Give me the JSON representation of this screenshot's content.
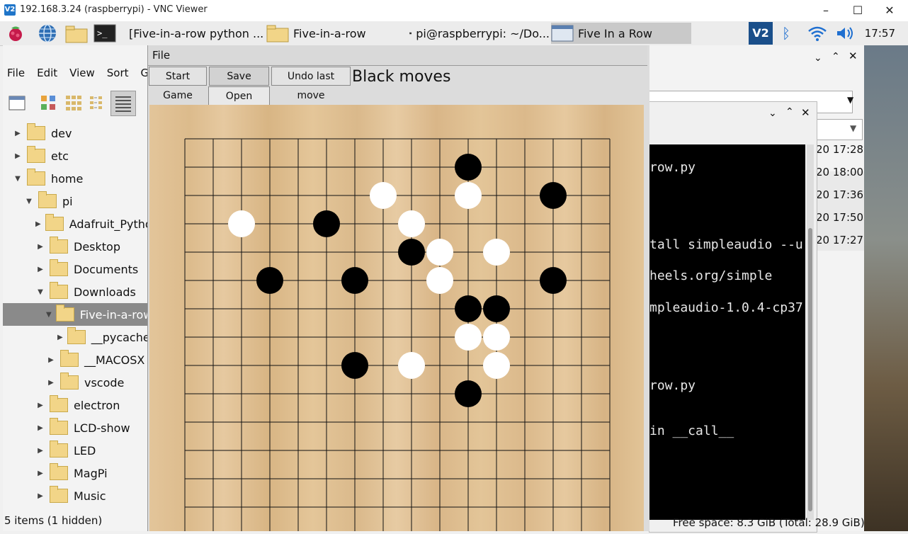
{
  "vnc": {
    "title": "192.168.3.24 (raspberrypi) - VNC Viewer",
    "logo": "V2"
  },
  "taskbar": {
    "tasks": [
      {
        "label": "[Five-in-a-row python ...",
        "icon": "chromium-icon"
      },
      {
        "label": "Five-in-a-row",
        "icon": "folder-icon"
      },
      {
        "label": "pi@raspberrypi: ~/Do...",
        "icon": "terminal-icon"
      },
      {
        "label": "Five In a Row",
        "icon": "window-icon"
      }
    ],
    "tray_logo": "V2",
    "clock": "17:57"
  },
  "file_manager": {
    "menu": [
      "File",
      "Edit",
      "View",
      "Sort",
      "Go"
    ],
    "tree": [
      {
        "label": "dev",
        "indent": 0,
        "arrow": "▶"
      },
      {
        "label": "etc",
        "indent": 0,
        "arrow": "▶"
      },
      {
        "label": "home",
        "indent": 0,
        "arrow": "▼"
      },
      {
        "label": "pi",
        "indent": 1,
        "arrow": "▼"
      },
      {
        "label": "Adafruit_Python",
        "indent": 2,
        "arrow": "▶"
      },
      {
        "label": "Desktop",
        "indent": 2,
        "arrow": "▶"
      },
      {
        "label": "Documents",
        "indent": 2,
        "arrow": "▶"
      },
      {
        "label": "Downloads",
        "indent": 2,
        "arrow": "▼"
      },
      {
        "label": "Five-in-a-row",
        "indent": 3,
        "arrow": "▼",
        "selected": true
      },
      {
        "label": "__pycache_",
        "indent": 4,
        "arrow": "▶"
      },
      {
        "label": "__MACOSX",
        "indent": 3,
        "arrow": "▶"
      },
      {
        "label": "vscode",
        "indent": 3,
        "arrow": "▶"
      },
      {
        "label": "electron",
        "indent": 2,
        "arrow": "▶"
      },
      {
        "label": "LCD-show",
        "indent": 2,
        "arrow": "▶"
      },
      {
        "label": "LED",
        "indent": 2,
        "arrow": "▶"
      },
      {
        "label": "MagPi",
        "indent": 2,
        "arrow": "▶"
      },
      {
        "label": "Music",
        "indent": 2,
        "arrow": "▶"
      }
    ],
    "status": "5 items (1 hidden)"
  },
  "game": {
    "menu_file": "File",
    "buttons": {
      "start": "Start Game",
      "save": "Save Game",
      "undo": "Undo last move",
      "open": "Open Game"
    },
    "status": "Black moves",
    "board": {
      "black": [
        [
          10,
          1
        ],
        [
          13,
          2
        ],
        [
          5,
          3
        ],
        [
          8,
          4
        ],
        [
          3,
          5
        ],
        [
          6,
          5
        ],
        [
          13,
          5
        ],
        [
          10,
          6
        ],
        [
          11,
          6
        ],
        [
          6,
          8
        ],
        [
          10,
          9
        ]
      ],
      "white": [
        [
          7,
          2
        ],
        [
          10,
          2
        ],
        [
          2,
          3
        ],
        [
          8,
          3
        ],
        [
          9,
          4
        ],
        [
          11,
          4
        ],
        [
          9,
          5
        ],
        [
          10,
          7
        ],
        [
          11,
          7
        ],
        [
          8,
          8
        ],
        [
          11,
          8
        ]
      ]
    }
  },
  "terminal": {
    "lines": [
      "row.py",
      "tall simpleaudio --u",
      "heels.org/simple",
      "mpleaudio-1.0.4-cp37",
      "row.py",
      "in __call__"
    ]
  },
  "right_fm": {
    "timestamps": [
      "20 17:28",
      "20 18:00",
      "20 17:36",
      "20 17:50",
      "20 17:27"
    ],
    "free_space": "Free space: 8.3 GiB (Total: 28.9 GiB)"
  }
}
